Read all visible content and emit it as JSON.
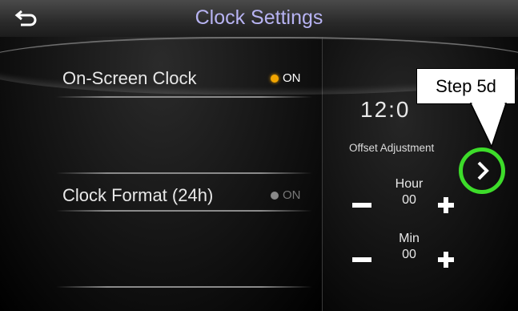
{
  "header": {
    "title": "Clock Settings",
    "back_icon": "back-arrow-icon"
  },
  "settings": {
    "on_screen_clock": {
      "label": "On-Screen Clock",
      "status": "ON",
      "status_color": "#f2a500"
    },
    "clock_format": {
      "label": "Clock Format (24h)",
      "status": "ON",
      "status_color": "#888888"
    }
  },
  "clock": {
    "time": "12:0",
    "offset_label": "Offset Adjustment"
  },
  "hour": {
    "label": "Hour",
    "value": "00"
  },
  "min": {
    "label": "Min",
    "value": "00"
  },
  "annotation": {
    "callout": "Step 5d",
    "highlight_color": "#3ddc2a",
    "next_icon": "chevron-right-icon"
  }
}
